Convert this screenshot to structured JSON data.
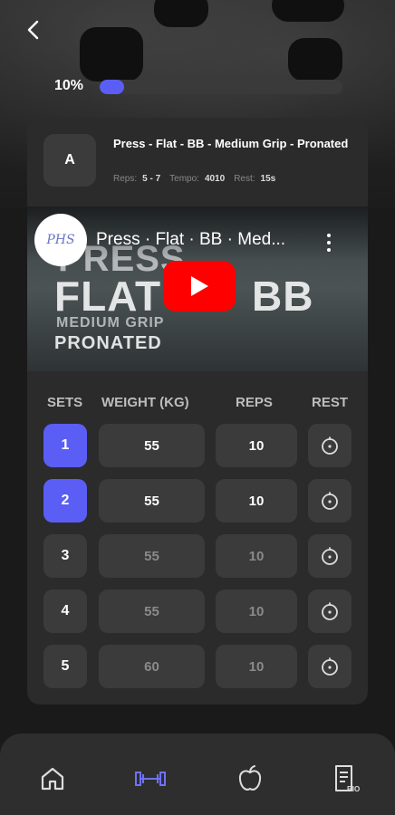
{
  "progress": {
    "label": "10%",
    "value": 0.1
  },
  "exercise": {
    "badge": "A",
    "title": "Press - Flat - BB - Medium Grip - Pronated",
    "reps_label": "Reps:",
    "reps_value": "5 - 7",
    "tempo_label": "Tempo:",
    "tempo_value": "4010",
    "rest_label": "Rest:",
    "rest_value": "15s"
  },
  "video": {
    "channel_logo_text": "PHS",
    "title": "Press · Flat · BB · Med...",
    "overlay_line1": "PRESS",
    "overlay_line2": "FLAT",
    "overlay_line3": "BB",
    "overlay_line4": "MEDIUM GRIP",
    "overlay_line5": "PRONATED"
  },
  "table": {
    "headers": {
      "sets": "SETS",
      "weight": "WEIGHT (KG)",
      "reps": "REPS",
      "rest": "REST"
    },
    "rows": [
      {
        "set": "1",
        "weight": "55",
        "reps": "10",
        "done": true
      },
      {
        "set": "2",
        "weight": "55",
        "reps": "10",
        "done": true
      },
      {
        "set": "3",
        "weight": "55",
        "reps": "10",
        "done": false
      },
      {
        "set": "4",
        "weight": "55",
        "reps": "10",
        "done": false
      },
      {
        "set": "5",
        "weight": "60",
        "reps": "10",
        "done": false
      }
    ]
  },
  "nav": {
    "items": [
      "home-icon",
      "dumbbell-icon",
      "apple-icon",
      "bio-document-icon"
    ],
    "active": "dumbbell-icon",
    "bio_label": "BIO"
  },
  "colors": {
    "accent": "#5b5ef5",
    "card": "#2b2b2b",
    "cell": "#3b3b3b",
    "youtube": "#ff0000"
  }
}
